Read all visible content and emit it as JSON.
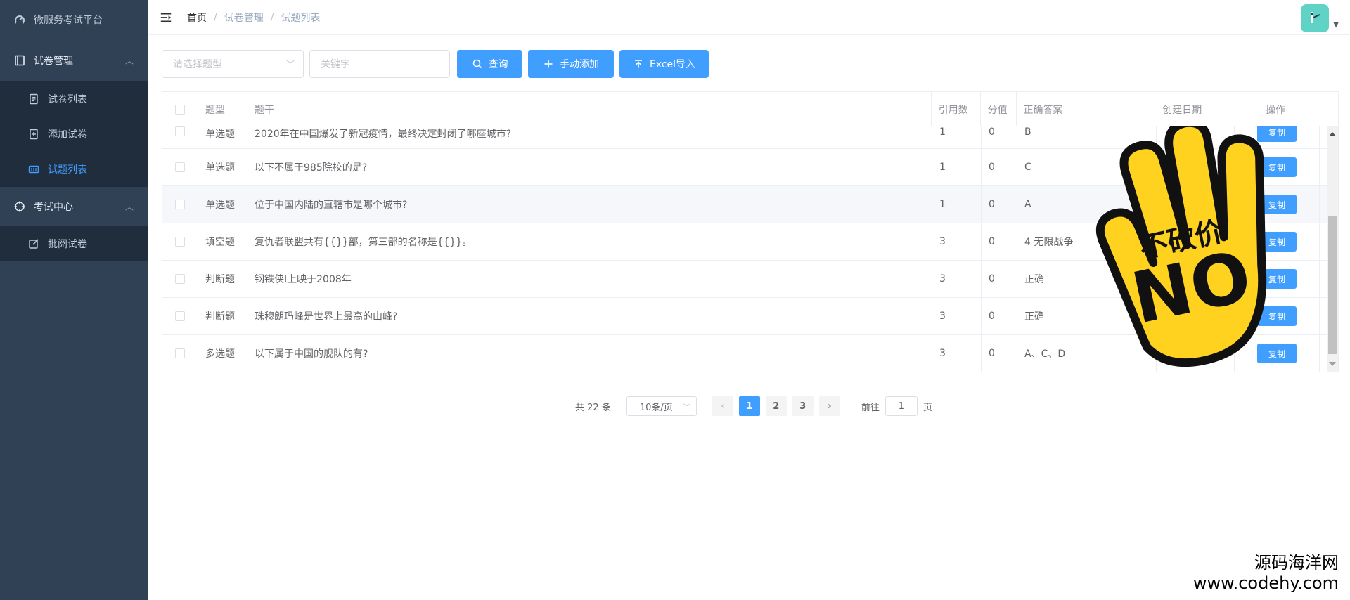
{
  "sidebar": {
    "brand": "微服务考试平台",
    "groups": [
      {
        "label": "试卷管理",
        "items": [
          "试卷列表",
          "添加试卷",
          "试题列表"
        ]
      },
      {
        "label": "考试中心",
        "items": [
          "批阅试卷"
        ]
      }
    ],
    "active_item": "试题列表"
  },
  "header": {
    "breadcrumb": [
      "首页",
      "试卷管理",
      "试题列表"
    ],
    "separator": "/"
  },
  "filters": {
    "type_placeholder": "请选择题型",
    "keyword_placeholder": "关键字",
    "search_label": "查询",
    "add_label": "手动添加",
    "import_label": "Excel导入"
  },
  "table": {
    "columns": [
      "题型",
      "题干",
      "引用数",
      "分值",
      "正确答案",
      "创建日期",
      "操作"
    ],
    "rows": [
      {
        "type": "单选题",
        "stem": "2020年在中国爆发了新冠疫情，最终决定封闭了哪座城市?",
        "refs": "1",
        "score": "0",
        "answer": "B",
        "date": "",
        "action": "复制"
      },
      {
        "type": "单选题",
        "stem": "以下不属于985院校的是?",
        "refs": "1",
        "score": "0",
        "answer": "C",
        "date": "",
        "action": "复制"
      },
      {
        "type": "单选题",
        "stem": "位于中国内陆的直辖市是哪个城市?",
        "refs": "1",
        "score": "0",
        "answer": "A",
        "date": "",
        "action": "复制"
      },
      {
        "type": "填空题",
        "stem": "复仇者联盟共有{{}}部，第三部的名称是{{}}。",
        "refs": "3",
        "score": "0",
        "answer": "4 无限战争",
        "date": "",
        "action": "复制"
      },
      {
        "type": "判断题",
        "stem": "钢铁侠Ⅰ上映于2008年",
        "refs": "3",
        "score": "0",
        "answer": "正确",
        "date": "",
        "action": "复制"
      },
      {
        "type": "判断题",
        "stem": "珠穆朗玛峰是世界上最高的山峰?",
        "refs": "3",
        "score": "0",
        "answer": "正确",
        "date": "",
        "action": "复制"
      },
      {
        "type": "多选题",
        "stem": "以下属于中国的舰队的有?",
        "refs": "3",
        "score": "0",
        "answer": "A、C、D",
        "date": "",
        "action": "复制"
      }
    ]
  },
  "pagination": {
    "total_text": "共 22 条",
    "page_size": "10条/页",
    "pages": [
      "1",
      "2",
      "3"
    ],
    "current": "1",
    "goto_prefix": "前往",
    "goto_value": "1",
    "goto_suffix": "页"
  },
  "overlay": {
    "stamp_text_top": "不砍价",
    "stamp_text_big": "NO"
  },
  "watermark": {
    "name": "源码海洋网",
    "url": "www.codehy.com"
  },
  "colors": {
    "sidebar_bg": "#304156",
    "sidebar_sub_bg": "#1f2d3d",
    "primary": "#409eff",
    "stamp_yellow": "#ffd21f"
  }
}
